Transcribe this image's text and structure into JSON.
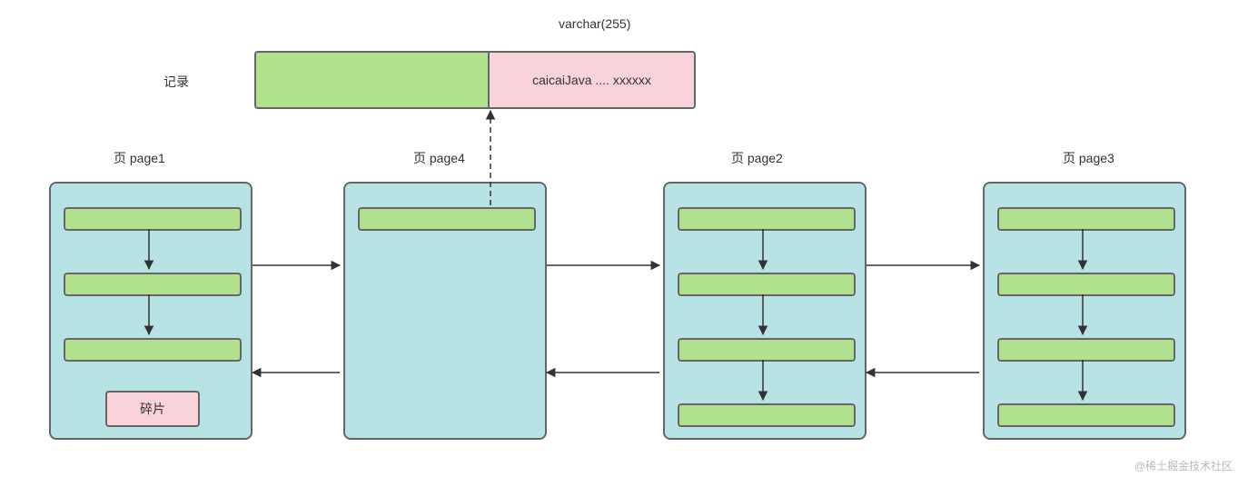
{
  "top": {
    "title": "varchar(255)",
    "record_label": "记录",
    "value": "caicaiJava .... xxxxxx"
  },
  "pages": {
    "p1": {
      "title": "页 page1",
      "fragment": "碎片"
    },
    "p4": {
      "title": "页 page4"
    },
    "p2": {
      "title": "页 page2"
    },
    "p3": {
      "title": "页 page3"
    }
  },
  "watermark": "@稀土掘金技术社区"
}
